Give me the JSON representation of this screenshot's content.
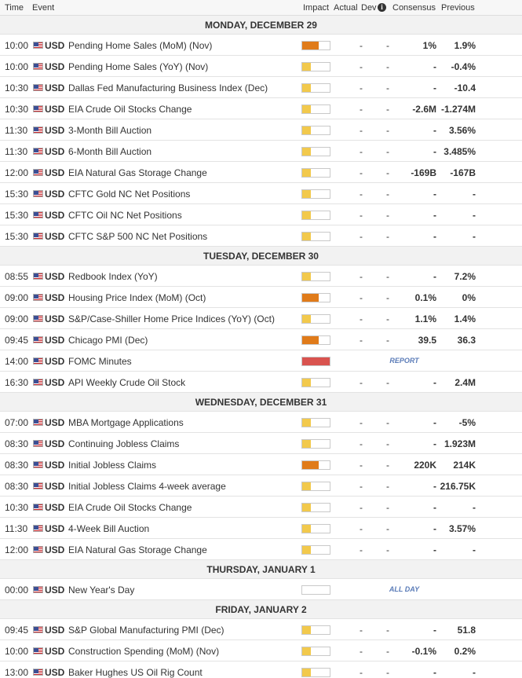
{
  "colors": {
    "impact_high": "#e07b1a",
    "impact_medium": "#f2c94c",
    "impact_holiday": "#ffffff",
    "impact_report": "#d9534f"
  },
  "header": {
    "time": "Time",
    "event": "Event",
    "impact": "Impact",
    "actual": "Actual",
    "dev": "Dev",
    "dev_icon": "info-icon",
    "consensus": "Consensus",
    "previous": "Previous"
  },
  "days": [
    {
      "label": "MONDAY, DECEMBER 29",
      "events": [
        {
          "time": "10:00",
          "currency": "USD",
          "event": "Pending Home Sales (MoM) (Nov)",
          "impact": "high",
          "impact_level": 0.6,
          "actual": "-",
          "dev": "-",
          "consensus": "1%",
          "previous": "1.9%",
          "tag": ""
        },
        {
          "time": "10:00",
          "currency": "USD",
          "event": "Pending Home Sales (YoY) (Nov)",
          "impact": "medium",
          "impact_level": 0.3,
          "actual": "-",
          "dev": "-",
          "consensus": "-",
          "previous": "-0.4%",
          "tag": ""
        },
        {
          "time": "10:30",
          "currency": "USD",
          "event": "Dallas Fed Manufacturing Business Index (Dec)",
          "impact": "medium",
          "impact_level": 0.3,
          "actual": "-",
          "dev": "-",
          "consensus": "-",
          "previous": "-10.4",
          "tag": ""
        },
        {
          "time": "10:30",
          "currency": "USD",
          "event": "EIA Crude Oil Stocks Change",
          "impact": "medium",
          "impact_level": 0.3,
          "actual": "-",
          "dev": "-",
          "consensus": "-2.6M",
          "previous": "-1.274M",
          "tag": ""
        },
        {
          "time": "11:30",
          "currency": "USD",
          "event": "3-Month Bill Auction",
          "impact": "medium",
          "impact_level": 0.3,
          "actual": "-",
          "dev": "-",
          "consensus": "-",
          "previous": "3.56%",
          "tag": ""
        },
        {
          "time": "11:30",
          "currency": "USD",
          "event": "6-Month Bill Auction",
          "impact": "medium",
          "impact_level": 0.3,
          "actual": "-",
          "dev": "-",
          "consensus": "-",
          "previous": "3.485%",
          "tag": ""
        },
        {
          "time": "12:00",
          "currency": "USD",
          "event": "EIA Natural Gas Storage Change",
          "impact": "medium",
          "impact_level": 0.3,
          "actual": "-",
          "dev": "-",
          "consensus": "-169B",
          "previous": "-167B",
          "tag": ""
        },
        {
          "time": "15:30",
          "currency": "USD",
          "event": "CFTC Gold NC Net Positions",
          "impact": "medium",
          "impact_level": 0.3,
          "actual": "-",
          "dev": "-",
          "consensus": "-",
          "previous": "-",
          "tag": ""
        },
        {
          "time": "15:30",
          "currency": "USD",
          "event": "CFTC Oil NC Net Positions",
          "impact": "medium",
          "impact_level": 0.3,
          "actual": "-",
          "dev": "-",
          "consensus": "-",
          "previous": "-",
          "tag": ""
        },
        {
          "time": "15:30",
          "currency": "USD",
          "event": "CFTC S&P 500 NC Net Positions",
          "impact": "medium",
          "impact_level": 0.3,
          "actual": "-",
          "dev": "-",
          "consensus": "-",
          "previous": "-",
          "tag": ""
        }
      ]
    },
    {
      "label": "TUESDAY, DECEMBER 30",
      "events": [
        {
          "time": "08:55",
          "currency": "USD",
          "event": "Redbook Index (YoY)",
          "impact": "medium",
          "impact_level": 0.3,
          "actual": "-",
          "dev": "-",
          "consensus": "-",
          "previous": "7.2%",
          "tag": ""
        },
        {
          "time": "09:00",
          "currency": "USD",
          "event": "Housing Price Index (MoM) (Oct)",
          "impact": "high",
          "impact_level": 0.6,
          "actual": "-",
          "dev": "-",
          "consensus": "0.1%",
          "previous": "0%",
          "tag": ""
        },
        {
          "time": "09:00",
          "currency": "USD",
          "event": "S&P/Case-Shiller Home Price Indices (YoY) (Oct)",
          "impact": "medium",
          "impact_level": 0.3,
          "actual": "-",
          "dev": "-",
          "consensus": "1.1%",
          "previous": "1.4%",
          "tag": ""
        },
        {
          "time": "09:45",
          "currency": "USD",
          "event": "Chicago PMI (Dec)",
          "impact": "high",
          "impact_level": 0.6,
          "actual": "-",
          "dev": "-",
          "consensus": "39.5",
          "previous": "36.3",
          "tag": ""
        },
        {
          "time": "14:00",
          "currency": "USD",
          "event": "FOMC Minutes",
          "impact": "report",
          "impact_level": 1.0,
          "actual": "",
          "dev": "",
          "consensus": "",
          "previous": "",
          "tag": "REPORT"
        },
        {
          "time": "16:30",
          "currency": "USD",
          "event": "API Weekly Crude Oil Stock",
          "impact": "medium",
          "impact_level": 0.3,
          "actual": "-",
          "dev": "-",
          "consensus": "-",
          "previous": "2.4M",
          "tag": ""
        }
      ]
    },
    {
      "label": "WEDNESDAY, DECEMBER 31",
      "events": [
        {
          "time": "07:00",
          "currency": "USD",
          "event": "MBA Mortgage Applications",
          "impact": "medium",
          "impact_level": 0.3,
          "actual": "-",
          "dev": "-",
          "consensus": "-",
          "previous": "-5%",
          "tag": ""
        },
        {
          "time": "08:30",
          "currency": "USD",
          "event": "Continuing Jobless Claims",
          "impact": "medium",
          "impact_level": 0.3,
          "actual": "-",
          "dev": "-",
          "consensus": "-",
          "previous": "1.923M",
          "tag": ""
        },
        {
          "time": "08:30",
          "currency": "USD",
          "event": "Initial Jobless Claims",
          "impact": "high",
          "impact_level": 0.6,
          "actual": "-",
          "dev": "-",
          "consensus": "220K",
          "previous": "214K",
          "tag": ""
        },
        {
          "time": "08:30",
          "currency": "USD",
          "event": "Initial Jobless Claims 4-week average",
          "impact": "medium",
          "impact_level": 0.3,
          "actual": "-",
          "dev": "-",
          "consensus": "-",
          "previous": "216.75K",
          "tag": ""
        },
        {
          "time": "10:30",
          "currency": "USD",
          "event": "EIA Crude Oil Stocks Change",
          "impact": "medium",
          "impact_level": 0.3,
          "actual": "-",
          "dev": "-",
          "consensus": "-",
          "previous": "-",
          "tag": ""
        },
        {
          "time": "11:30",
          "currency": "USD",
          "event": "4-Week Bill Auction",
          "impact": "medium",
          "impact_level": 0.3,
          "actual": "-",
          "dev": "-",
          "consensus": "-",
          "previous": "3.57%",
          "tag": ""
        },
        {
          "time": "12:00",
          "currency": "USD",
          "event": "EIA Natural Gas Storage Change",
          "impact": "medium",
          "impact_level": 0.3,
          "actual": "-",
          "dev": "-",
          "consensus": "-",
          "previous": "-",
          "tag": ""
        }
      ]
    },
    {
      "label": "THURSDAY, JANUARY 1",
      "events": [
        {
          "time": "00:00",
          "currency": "USD",
          "event": "New Year's Day",
          "impact": "holiday",
          "impact_level": 0.0,
          "actual": "",
          "dev": "",
          "consensus": "",
          "previous": "",
          "tag": "ALL DAY"
        }
      ]
    },
    {
      "label": "FRIDAY, JANUARY 2",
      "events": [
        {
          "time": "09:45",
          "currency": "USD",
          "event": "S&P Global Manufacturing PMI (Dec)",
          "impact": "medium",
          "impact_level": 0.3,
          "actual": "-",
          "dev": "-",
          "consensus": "-",
          "previous": "51.8",
          "tag": ""
        },
        {
          "time": "10:00",
          "currency": "USD",
          "event": "Construction Spending (MoM) (Nov)",
          "impact": "medium",
          "impact_level": 0.3,
          "actual": "-",
          "dev": "-",
          "consensus": "-0.1%",
          "previous": "0.2%",
          "tag": ""
        },
        {
          "time": "13:00",
          "currency": "USD",
          "event": "Baker Hughes US Oil Rig Count",
          "impact": "medium",
          "impact_level": 0.3,
          "actual": "-",
          "dev": "-",
          "consensus": "-",
          "previous": "-",
          "tag": ""
        }
      ]
    }
  ]
}
